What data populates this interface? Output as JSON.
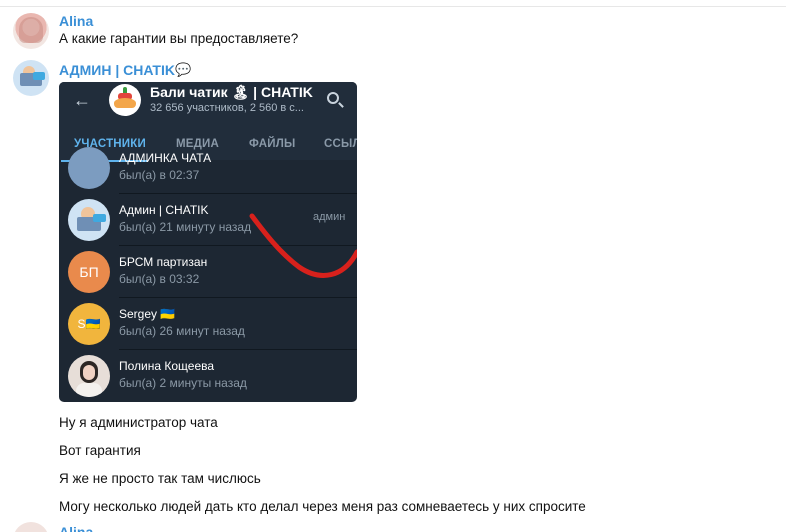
{
  "messages": [
    {
      "sender": "Alina",
      "text": "А какие гарантии вы предоставляете?"
    },
    {
      "sender": "АДМИН | CHATIK",
      "sender_icon": "speech-bubble-icon",
      "embedded_screenshot": {
        "back_icon": "←",
        "group_title": "Бали чатик 🏝 | CHATIK",
        "group_subtitle": "32 656 участников, 2 560 в с...",
        "tabs": [
          "УЧАСТНИКИ",
          "МЕДИА",
          "ФАЙЛЫ",
          "ССЫЛ"
        ],
        "members": [
          {
            "name": "АДМИНКА ЧАТА",
            "status": "был(а) в 02:37",
            "role": "",
            "initials": "",
            "color": "#7c9cc0"
          },
          {
            "name": "Админ | CHATIK",
            "status": "был(а) 21 минуту назад",
            "role": "админ",
            "initials": "",
            "color": "#cfe3f4"
          },
          {
            "name": "БРСМ партизан",
            "status": "был(а) в 03:32",
            "role": "",
            "initials": "БП",
            "color": "#e98a4c"
          },
          {
            "name": "Sergey 🇺🇦",
            "status": "был(а) 26 минут назад",
            "role": "",
            "initials": "S🇺🇦",
            "color": "#f1b53d"
          },
          {
            "name": "Полина Кощеева",
            "status": "был(а) 2 минуты назад",
            "role": "",
            "initials": "",
            "color": "#e7ded8"
          }
        ]
      },
      "texts": [
        "Ну я администратор чата",
        "Вот гарантия",
        "Я же не просто так там числюсь",
        "Могу несколько людей дать кто делал через меня раз сомневаетесь у них спросите"
      ]
    },
    {
      "sender": "Alina"
    }
  ]
}
